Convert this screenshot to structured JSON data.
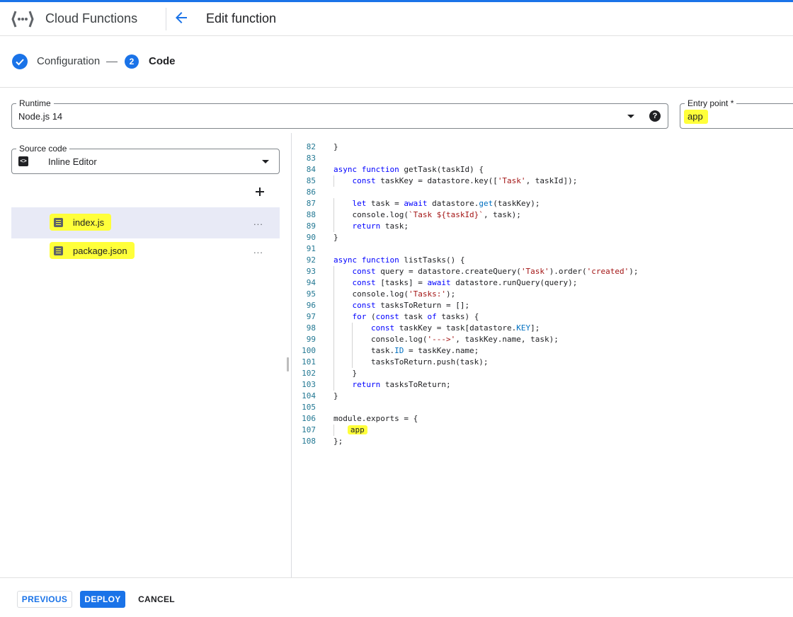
{
  "header": {
    "app_title": "Cloud Functions",
    "page_title": "Edit function"
  },
  "stepper": {
    "step1_label": "Configuration",
    "step2_number": "2",
    "step2_label": "Code"
  },
  "runtime": {
    "label": "Runtime",
    "value": "Node.js 14",
    "help_glyph": "?"
  },
  "entry_point": {
    "label": "Entry point *",
    "value": "app"
  },
  "source_code": {
    "label": "Source code",
    "value": "Inline Editor",
    "icon_glyph": "<>"
  },
  "files": [
    {
      "name": "index.js",
      "more": "...",
      "active": true
    },
    {
      "name": "package.json",
      "more": "...",
      "active": false
    }
  ],
  "code": {
    "lines": [
      {
        "n": "82",
        "t": "}"
      },
      {
        "n": "83",
        "t": ""
      },
      {
        "n": "84",
        "t": "async function getTask(taskId) {"
      },
      {
        "n": "85",
        "t": "    const taskKey = datastore.key(['Task', taskId]);"
      },
      {
        "n": "86",
        "t": ""
      },
      {
        "n": "87",
        "t": "    let task = await datastore.get(taskKey);"
      },
      {
        "n": "88",
        "t": "    console.log(`Task ${taskId}`, task);"
      },
      {
        "n": "89",
        "t": "    return task;"
      },
      {
        "n": "90",
        "t": "}"
      },
      {
        "n": "91",
        "t": ""
      },
      {
        "n": "92",
        "t": "async function listTasks() {"
      },
      {
        "n": "93",
        "t": "    const query = datastore.createQuery('Task').order('created');"
      },
      {
        "n": "94",
        "t": "    const [tasks] = await datastore.runQuery(query);"
      },
      {
        "n": "95",
        "t": "    console.log('Tasks:');"
      },
      {
        "n": "96",
        "t": "    const tasksToReturn = [];"
      },
      {
        "n": "97",
        "t": "    for (const task of tasks) {"
      },
      {
        "n": "98",
        "t": "        const taskKey = task[datastore.KEY];"
      },
      {
        "n": "99",
        "t": "        console.log('--->', taskKey.name, task);"
      },
      {
        "n": "100",
        "t": "        task.ID = taskKey.name;"
      },
      {
        "n": "101",
        "t": "        tasksToReturn.push(task);"
      },
      {
        "n": "102",
        "t": "    }"
      },
      {
        "n": "103",
        "t": "    return tasksToReturn;"
      },
      {
        "n": "104",
        "t": "}"
      },
      {
        "n": "105",
        "t": ""
      },
      {
        "n": "106",
        "t": "module.exports = {"
      },
      {
        "n": "107",
        "t": "    app"
      },
      {
        "n": "108",
        "t": "};"
      }
    ]
  },
  "footer": {
    "previous_label": "PREVIOUS",
    "deploy_label": "DEPLOY",
    "cancel_label": "CANCEL"
  },
  "colors": {
    "accent": "#1a73e8",
    "highlight": "#ffff3a",
    "keyword": "#0000ff",
    "string": "#a31515",
    "property": "#0070c1",
    "line_number": "#237893"
  }
}
